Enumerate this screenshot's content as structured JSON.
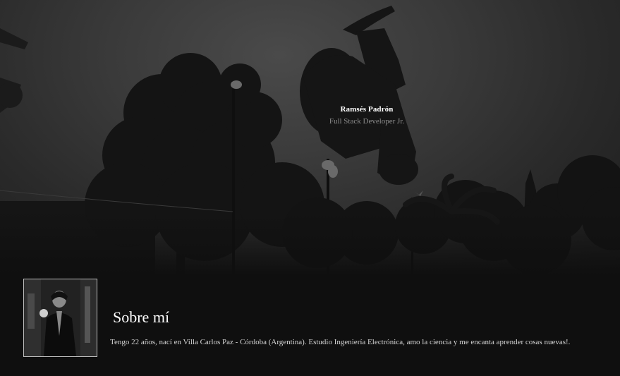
{
  "hero": {
    "name": "Ramsés Padrón",
    "role": "Full Stack Developer Jr."
  },
  "about": {
    "title": "Sobre mí",
    "text": "Tengo 22 años, nací en Villa Carlos Paz - Córdoba (Argentina). Estudio Ingeniería Electrónica, amo la ciencia y me encanta aprender cosas nuevas!."
  }
}
